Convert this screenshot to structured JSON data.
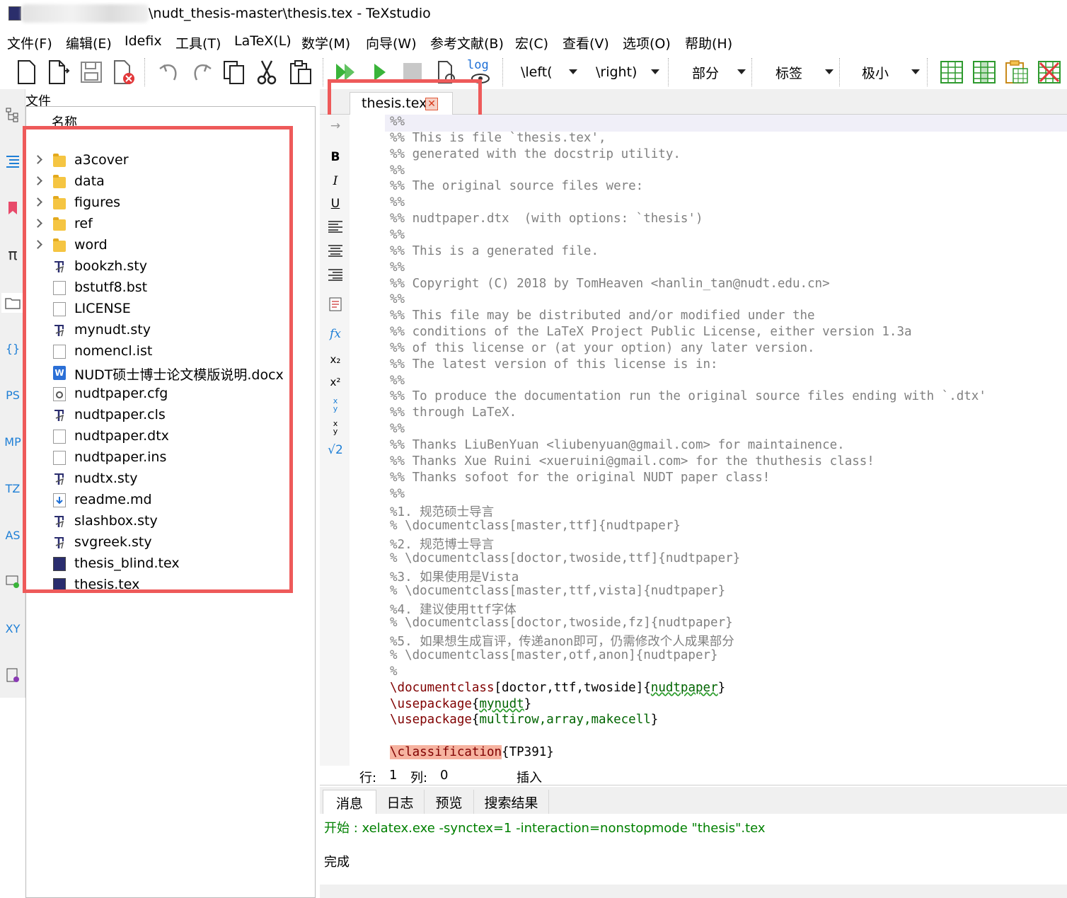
{
  "window": {
    "title": "\\nudt_thesis-master\\thesis.tex - TeXstudio"
  },
  "menu": [
    {
      "label": "文件(F)"
    },
    {
      "label": "编辑(E)"
    },
    {
      "label": "Idefix"
    },
    {
      "label": "工具(T)"
    },
    {
      "label": "LaTeX(L)"
    },
    {
      "label": "数学(M)"
    },
    {
      "label": "向导(W)"
    },
    {
      "label": "参考文献(B)"
    },
    {
      "label": "宏(C)"
    },
    {
      "label": "查看(V)"
    },
    {
      "label": "选项(O)"
    },
    {
      "label": "帮助(H)"
    }
  ],
  "toolbar": {
    "log_label": "log",
    "left_combo": "\\left(",
    "right_combo": "\\right)",
    "section_combo": "部分",
    "label_combo": "标签",
    "size_combo": "极小"
  },
  "side_panel": {
    "title": "文件",
    "column_header": "名称",
    "items": [
      {
        "name": "a3cover",
        "icon": "folder-icon",
        "expandable": true
      },
      {
        "name": "data",
        "icon": "folder-icon",
        "expandable": true
      },
      {
        "name": "figures",
        "icon": "folder-icon",
        "expandable": true
      },
      {
        "name": "ref",
        "icon": "folder-icon",
        "expandable": true
      },
      {
        "name": "word",
        "icon": "folder-icon",
        "expandable": true
      },
      {
        "name": "bookzh.sty",
        "icon": "sty-file-icon",
        "expandable": false
      },
      {
        "name": "bstutf8.bst",
        "icon": "blank-file-icon",
        "expandable": false
      },
      {
        "name": "LICENSE",
        "icon": "blank-file-icon",
        "expandable": false
      },
      {
        "name": "mynudt.sty",
        "icon": "sty-file-icon",
        "expandable": false
      },
      {
        "name": "nomencl.ist",
        "icon": "blank-file-icon",
        "expandable": false
      },
      {
        "name": "NUDT硕士博士论文模版说明.docx",
        "icon": "word-file-icon",
        "expandable": false
      },
      {
        "name": "nudtpaper.cfg",
        "icon": "cfg-file-icon",
        "expandable": false
      },
      {
        "name": "nudtpaper.cls",
        "icon": "sty-file-icon",
        "expandable": false
      },
      {
        "name": "nudtpaper.dtx",
        "icon": "blank-file-icon",
        "expandable": false
      },
      {
        "name": "nudtpaper.ins",
        "icon": "blank-file-icon",
        "expandable": false
      },
      {
        "name": "nudtx.sty",
        "icon": "sty-file-icon",
        "expandable": false
      },
      {
        "name": "readme.md",
        "icon": "md-file-icon",
        "expandable": false
      },
      {
        "name": "slashbox.sty",
        "icon": "sty-file-icon",
        "expandable": false
      },
      {
        "name": "svgreek.sty",
        "icon": "sty-file-icon",
        "expandable": false
      },
      {
        "name": "thesis_blind.tex",
        "icon": "tex-file-icon",
        "expandable": false
      },
      {
        "name": "thesis.tex",
        "icon": "tex-file-icon",
        "expandable": false
      }
    ]
  },
  "left_strip": [
    "structure-icon",
    "outline-icon",
    "bookmark-icon",
    "symbols-icon",
    "files-icon",
    "braces-icon",
    "PS",
    "MP",
    "TZ",
    "AS",
    "preview-icon",
    "XY",
    "script-icon"
  ],
  "editor": {
    "tab_label": "thesis.tex",
    "lines": [
      "%%",
      "%% This is file `thesis.tex',",
      "%% generated with the docstrip utility.",
      "%%",
      "%% The original source files were:",
      "%%",
      "%% nudtpaper.dtx  (with options: `thesis')",
      "%%",
      "%% This is a generated file.",
      "%%",
      "%% Copyright (C) 2018 by TomHeaven <hanlin_tan@nudt.edu.cn>",
      "%%",
      "%% This file may be distributed and/or modified under the",
      "%% conditions of the LaTeX Project Public License, either version 1.3a",
      "%% of this license or (at your option) any later version.",
      "%% The latest version of this license is in:",
      "%%",
      "%% To produce the documentation run the original source files ending with `.dtx'",
      "%% through LaTeX.",
      "%%",
      "%% Thanks LiuBenYuan <liubenyuan@gmail.com> for maintainence.",
      "%% Thanks Xue Ruini <xueruini@gmail.com> for the thuthesis class!",
      "%% Thanks sofoot for the original NUDT paper class!",
      "%%",
      "%1. 规范硕士导言",
      "% \\documentclass[master,ttf]{nudtpaper}",
      "%2. 规范博士导言",
      "% \\documentclass[doctor,twoside,ttf]{nudtpaper}",
      "%3. 如果使用是Vista",
      "% \\documentclass[master,ttf,vista]{nudtpaper}",
      "%4. 建议使用ttf字体",
      "% \\documentclass[doctor,twoside,fz]{nudtpaper}",
      "%5. 如果想生成盲评，传递anon即可，仍需修改个人成果部分",
      "% \\documentclass[master,otf,anon]{nudtpaper}",
      "%"
    ],
    "code": {
      "documentclass_cmd": "\\documentclass",
      "documentclass_opts": "[doctor,ttf,twoside]",
      "documentclass_arg": "nudtpaper",
      "usepackage1_cmd": "\\usepackage",
      "usepackage1_arg": "mynudt",
      "usepackage2_cmd": "\\usepackage",
      "usepackage2_arg": "multirow,array,makecell",
      "classification_cmd": "\\classification",
      "classification_arg": "TP391"
    }
  },
  "status": {
    "line_label": "行:",
    "line_value": "1",
    "col_label": "列:",
    "col_value": "0",
    "mode": "插入"
  },
  "bottom_tabs": [
    {
      "label": "消息"
    },
    {
      "label": "日志"
    },
    {
      "label": "预览"
    },
    {
      "label": "搜索结果"
    }
  ],
  "messages": {
    "start": "开始 : xelatex.exe -synctex=1 -interaction=nonstopmode \"thesis\".tex",
    "done": "完成"
  },
  "colors": {
    "highlight_box": "#ee5a5a",
    "message_green": "#008000",
    "comment_gray": "#808080",
    "command_maroon": "#800000",
    "argument_green": "#006400"
  }
}
